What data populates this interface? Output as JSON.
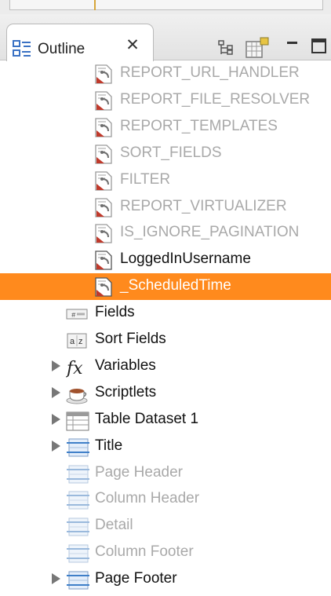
{
  "view": {
    "tab_title": "Outline"
  },
  "tree": {
    "parameters": [
      {
        "label": "REPORT_URL_HANDLER",
        "dim": true
      },
      {
        "label": "REPORT_FILE_RESOLVER",
        "dim": true
      },
      {
        "label": "REPORT_TEMPLATES",
        "dim": true
      },
      {
        "label": "SORT_FIELDS",
        "dim": true
      },
      {
        "label": "FILTER",
        "dim": true
      },
      {
        "label": "REPORT_VIRTUALIZER",
        "dim": true
      },
      {
        "label": "IS_IGNORE_PAGINATION",
        "dim": true
      },
      {
        "label": "LoggedInUsername",
        "dim": false
      },
      {
        "label": "_ScheduledTime",
        "dim": false,
        "selected": true
      }
    ],
    "nodes": [
      {
        "label": "Fields",
        "icon": "fields-icon",
        "expandable": false,
        "dim": false
      },
      {
        "label": "Sort Fields",
        "icon": "sort-fields-icon",
        "expandable": false,
        "dim": false
      },
      {
        "label": "Variables",
        "icon": "fx-icon",
        "expandable": true,
        "dim": false
      },
      {
        "label": "Scriptlets",
        "icon": "coffee-cup-icon",
        "expandable": true,
        "dim": false
      },
      {
        "label": "Table Dataset 1",
        "icon": "table-icon",
        "expandable": true,
        "dim": false
      },
      {
        "label": "Title",
        "icon": "band-icon",
        "expandable": true,
        "dim": false
      },
      {
        "label": "Page Header",
        "icon": "band-icon",
        "expandable": false,
        "dim": true
      },
      {
        "label": "Column Header",
        "icon": "band-icon",
        "expandable": false,
        "dim": true
      },
      {
        "label": "Detail",
        "icon": "band-icon",
        "expandable": false,
        "dim": true
      },
      {
        "label": "Column Footer",
        "icon": "band-icon",
        "expandable": false,
        "dim": true
      },
      {
        "label": "Page Footer",
        "icon": "band-icon",
        "expandable": true,
        "dim": false
      }
    ]
  },
  "colors": {
    "selection": "#ff8a1d",
    "dim_text": "#a9a9a9",
    "text": "#111111"
  }
}
